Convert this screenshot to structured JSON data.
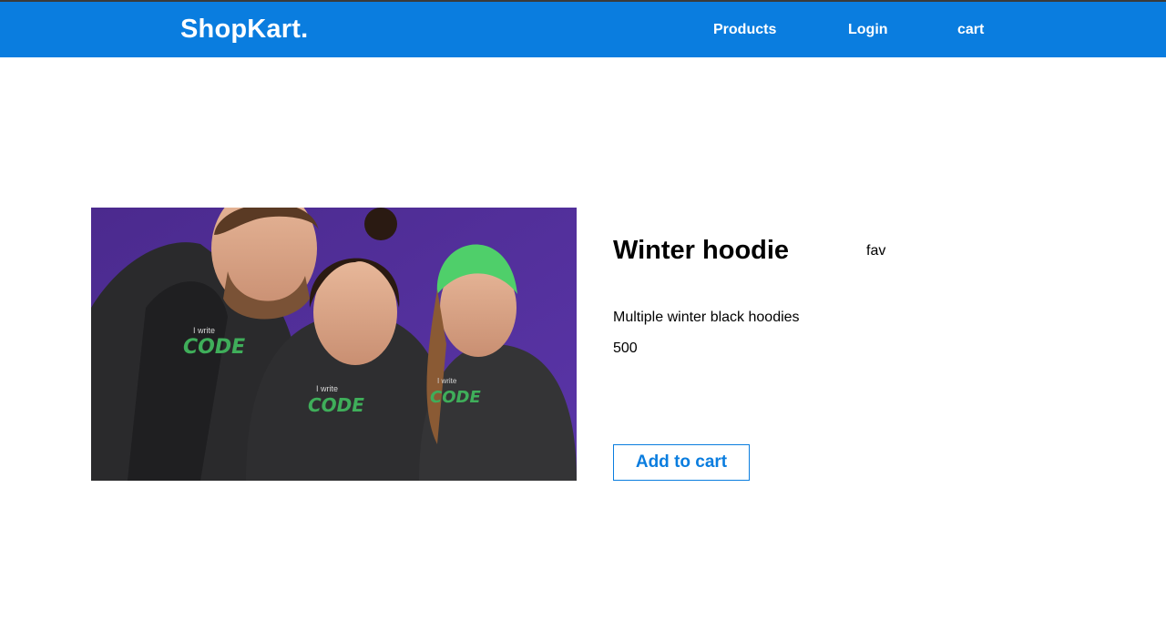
{
  "header": {
    "brand": "ShopKart.",
    "nav": {
      "products": "Products",
      "login": "Login",
      "cart": "cart"
    },
    "color": "#0a7ddf"
  },
  "product": {
    "title": "Winter hoodie",
    "fav_label": "fav",
    "description": "Multiple winter black hoodies",
    "price": "500",
    "add_to_cart_label": "Add to cart",
    "image": {
      "hoodie_print_small": "I write",
      "hoodie_print_large": "CODE"
    }
  }
}
